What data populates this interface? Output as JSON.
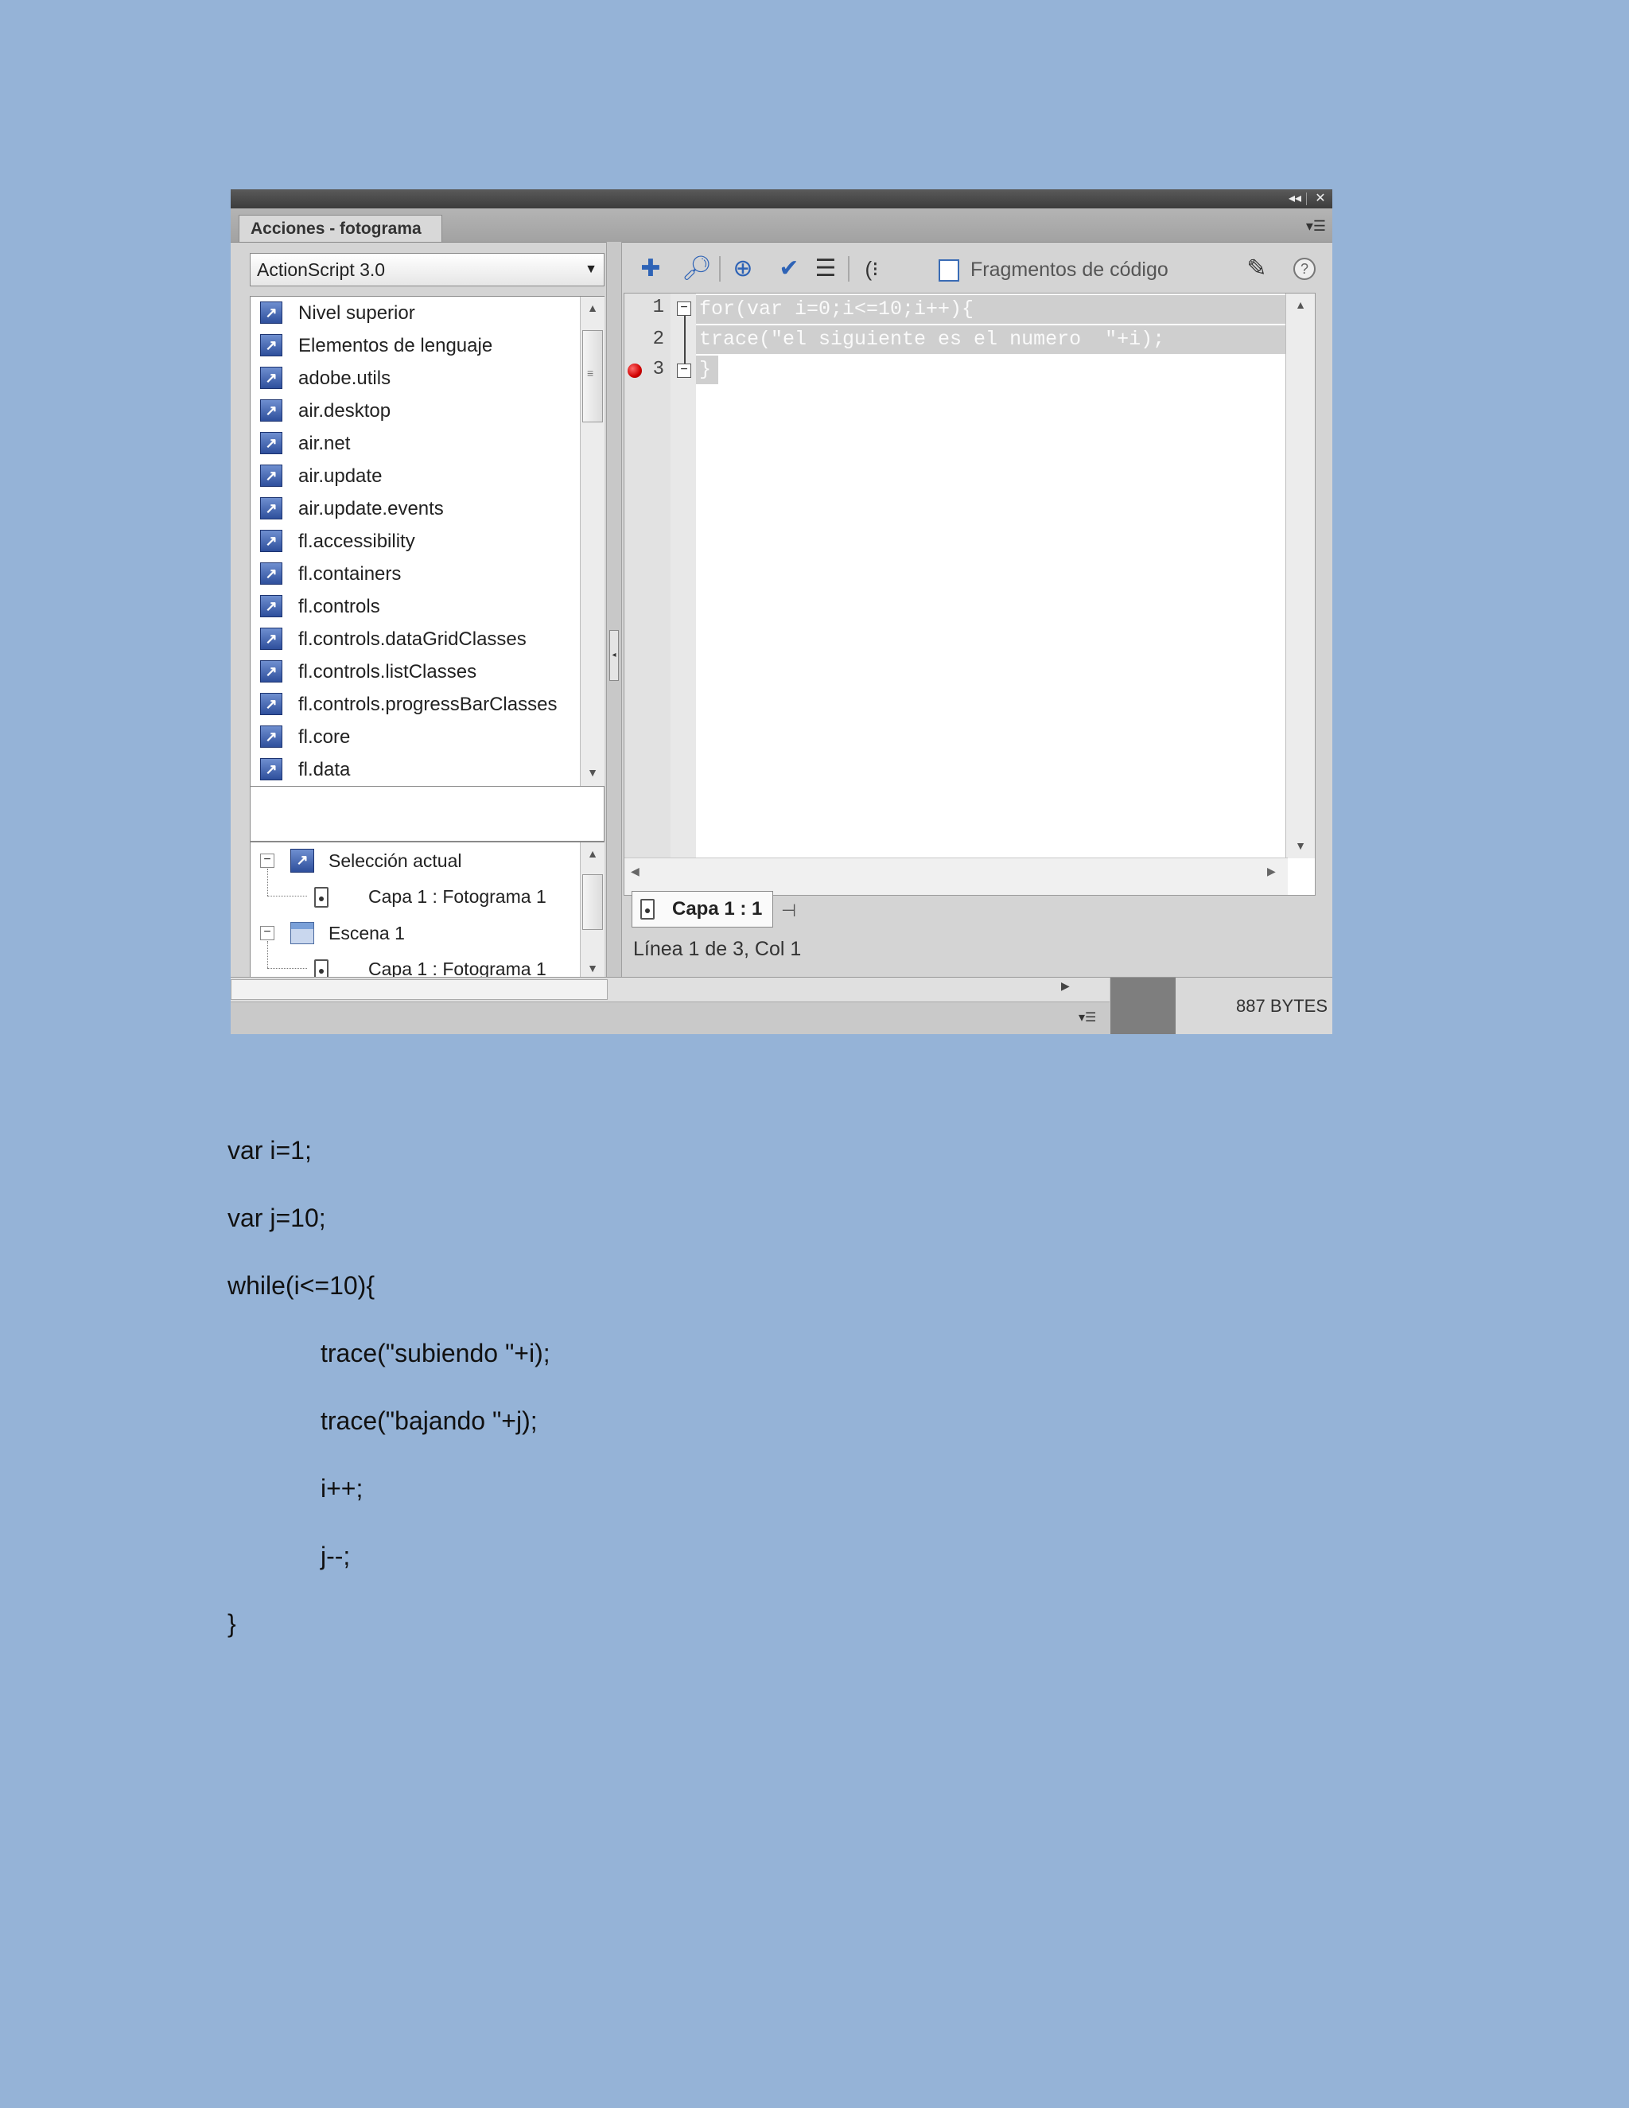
{
  "panel": {
    "title": "Acciones - fotograma",
    "language": "ActionScript 3.0",
    "library": [
      "Nivel superior",
      "Elementos de lenguaje",
      "adobe.utils",
      "air.desktop",
      "air.net",
      "air.update",
      "air.update.events",
      "fl.accessibility",
      "fl.containers",
      "fl.controls",
      "fl.controls.dataGridClasses",
      "fl.controls.listClasses",
      "fl.controls.progressBarClasses",
      "fl.core",
      "fl.data"
    ],
    "tree": {
      "current_selection": "Selección actual",
      "current_frame": "Capa 1 : Fotograma 1",
      "scene": "Escena 1",
      "scene_frame": "Capa 1 : Fotograma 1"
    },
    "toolbar": {
      "snippets_label": "Fragmentos de código"
    },
    "editor": {
      "line_numbers": [
        "1",
        "2",
        "3"
      ],
      "code": [
        "for(var i=0;i<=10;i++){",
        "trace(\"el siguiente es el numero  \"+i);",
        "}"
      ]
    },
    "script_tab": "Capa 1 : 1",
    "status": "Línea 1 de 3, Col 1",
    "bytes": "887 BYTES"
  },
  "document_code": [
    "var i=1;",
    "var j=10;",
    "while(i<=10){",
    "trace(\"subiendo \"+i);",
    "trace(\"bajando \"+j);",
    "i++;",
    "j--;",
    "}"
  ]
}
